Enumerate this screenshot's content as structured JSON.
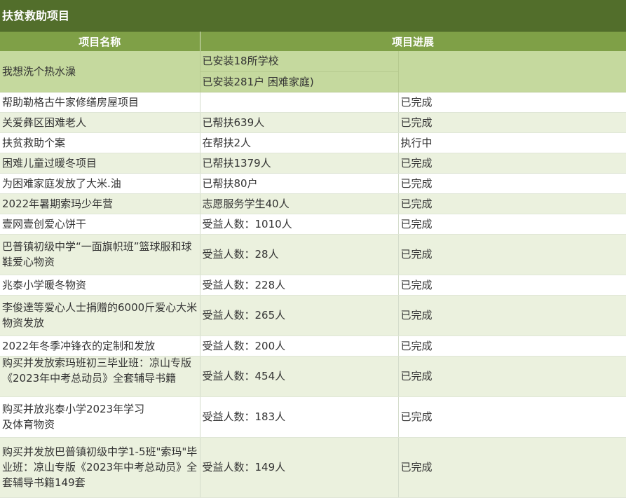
{
  "title": "扶贫救助项目",
  "headers": {
    "name": "项目名称",
    "progress": "项目进展"
  },
  "rows": [
    {
      "name": "我想洗个热水澡",
      "sub": [
        "已安装18所学校",
        "已安装281户 困难家庭)"
      ],
      "status": ""
    },
    {
      "name": "帮助勒格古牛家修缮房屋项目",
      "detail": "",
      "status": "已完成"
    },
    {
      "name": "关爱彝区困难老人",
      "detail": "已帮扶639人",
      "status": "已完成"
    },
    {
      "name": "扶贫救助个案",
      "detail": "在帮扶2人",
      "status": "执行中"
    },
    {
      "name": "困难儿童过暖冬项目",
      "detail": "已帮扶1379人",
      "status": "已完成"
    },
    {
      "name": "为困难家庭发放了大米.油",
      "detail": "已帮扶80户",
      "status": "已完成"
    },
    {
      "name": "2022年暑期索玛少年营",
      "detail": "志愿服务学生40人",
      "status": "已完成"
    },
    {
      "name": "壹网壹创爱心饼干",
      "detail": "受益人数：1010人",
      "status": "已完成"
    },
    {
      "name": "巴普镇初级中学“一面旗帜班”篮球服和球鞋爱心物资",
      "detail": "受益人数：28人",
      "status": "已完成"
    },
    {
      "name": "兆泰小学暖冬物资",
      "detail": "受益人数：228人",
      "status": "已完成"
    },
    {
      "name": "李俊達等爱心人士捐赠的6000斤爱心大米物资发放",
      "detail": "受益人数：265人",
      "status": "已完成"
    },
    {
      "name": "2022年冬季冲锋衣的定制和发放",
      "detail": "受益人数：200人",
      "status": "已完成"
    },
    {
      "name": "购买并发放索玛班初三毕业班：凉山专版《2023年中考总动员》全套辅导书籍",
      "detail": "受益人数：454人",
      "status": "已完成"
    },
    {
      "name": "购买并放兆泰小学2023年学习\n及体育物资",
      "detail": "受益人数：183人",
      "status": "已完成"
    },
    {
      "name": "购买并发放巴普镇初级中学1-5班\"索玛\"毕业班：凉山专版《2023年中考总动员》全套辅导书籍149套",
      "detail": "受益人数：149人",
      "status": "已完成"
    }
  ]
}
